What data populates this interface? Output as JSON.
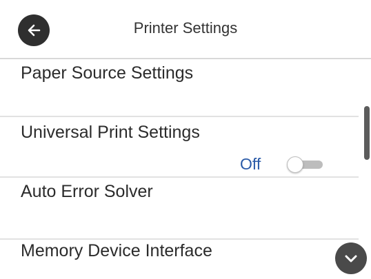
{
  "header": {
    "title": "Printer Settings",
    "back_icon": "back-arrow-icon"
  },
  "list": {
    "items": [
      {
        "label": "Paper Source Settings"
      },
      {
        "label": "Universal Print Settings"
      },
      {
        "label": "Auto Error Solver",
        "status": "Off",
        "toggle_on": false
      },
      {
        "label": "Memory Device Interface"
      }
    ]
  },
  "scroll": {
    "down_icon": "chevron-down-icon"
  },
  "colors": {
    "status_text": "#2a5aa8",
    "button_dark": "#2f2f2f",
    "divider": "#e2e2e2"
  }
}
